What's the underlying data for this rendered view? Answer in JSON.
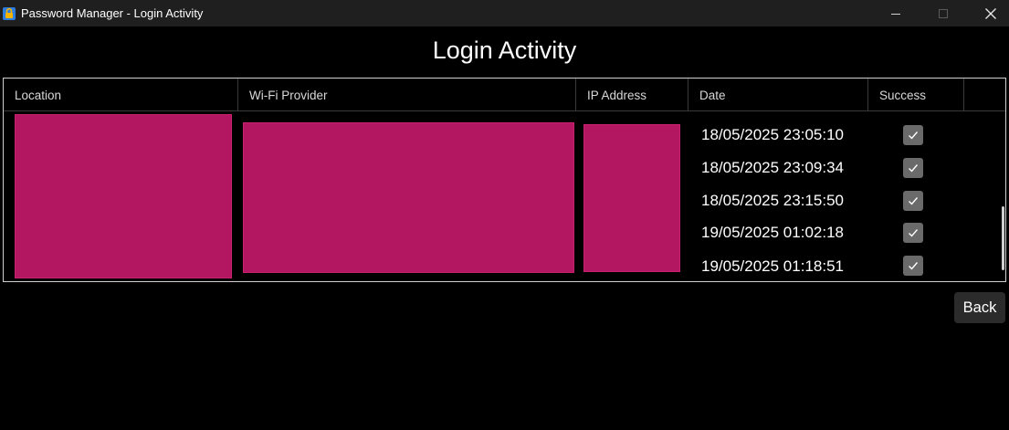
{
  "window": {
    "title": "Password Manager - Login Activity",
    "icon": "lock-icon"
  },
  "page": {
    "title": "Login Activity"
  },
  "table": {
    "columns": [
      "Location",
      "Wi-Fi Provider",
      "IP Address",
      "Date",
      "Success"
    ],
    "rows": [
      {
        "date": "18/05/2025 23:05:10",
        "success": true
      },
      {
        "date": "18/05/2025 23:09:34",
        "success": true
      },
      {
        "date": "18/05/2025 23:15:50",
        "success": true
      },
      {
        "date": "19/05/2025 01:02:18",
        "success": true
      },
      {
        "date": "19/05/2025 01:18:51",
        "success": true
      }
    ]
  },
  "actions": {
    "back_label": "Back"
  },
  "colors": {
    "background": "#000000",
    "redaction": "#b41762",
    "checkbox": "#6a6a6a"
  }
}
